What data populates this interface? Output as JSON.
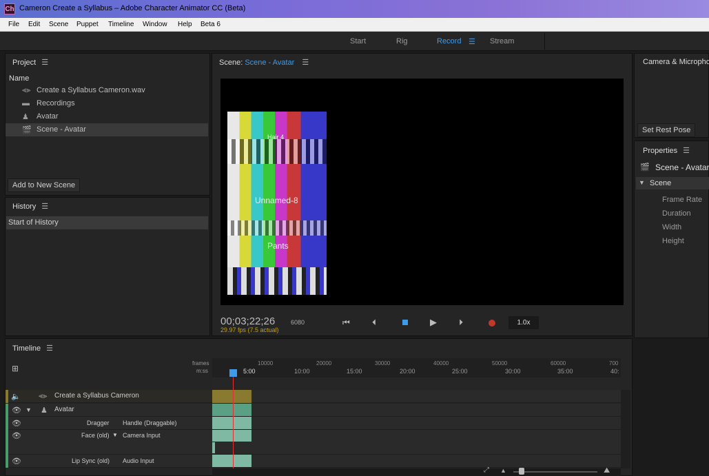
{
  "window": {
    "logo": "Ch",
    "title": "Cameron Create a Syllabus – Adobe Character Animator CC (Beta)"
  },
  "menu": [
    "File",
    "Edit",
    "Scene",
    "Puppet",
    "Timeline",
    "Window",
    "Help",
    "Beta 6"
  ],
  "workspaces": [
    "Start",
    "Rig",
    "Record",
    "Stream"
  ],
  "project": {
    "title": "Project",
    "col": "Name",
    "items": [
      {
        "icon": "audio-waveform-icon",
        "label": "Create a Syllabus Cameron.wav"
      },
      {
        "icon": "folder-icon",
        "label": "Recordings"
      },
      {
        "icon": "puppet-icon",
        "label": "Avatar"
      },
      {
        "icon": "clapperboard-icon",
        "label": "Scene - Avatar"
      }
    ],
    "add_button": "Add to New Scene"
  },
  "history": {
    "title": "History",
    "items": [
      "Start of History"
    ]
  },
  "scene": {
    "prefix": "Scene:",
    "name": "Scene - Avatar",
    "labels": [
      "Hair 4",
      "Unnamed-8",
      "Pants"
    ],
    "timecode": "00;03;22;26",
    "fps": "29.97 fps (7.5 actual)",
    "frame": "6080",
    "speed": "1.0x"
  },
  "camera": {
    "title": "Camera & Microphone",
    "rest": "Set Rest Pose"
  },
  "properties": {
    "title": "Properties",
    "scene_name": "Scene - Avatar",
    "section": "Scene",
    "fields": [
      "Frame Rate",
      "Duration",
      "Width",
      "Height"
    ]
  },
  "timeline": {
    "title": "Timeline",
    "frames_label": "frames",
    "mss_label": "m:ss",
    "frame_ticks": [
      "10000",
      "20000",
      "30000",
      "40000",
      "50000",
      "60000",
      "700"
    ],
    "time_ticks": [
      "5:00",
      "10:00",
      "15:00",
      "20:00",
      "25:00",
      "30:00",
      "35:00",
      "40:"
    ],
    "tracks": [
      {
        "name": "Create a Syllabus Cameron",
        "sub": ""
      },
      {
        "name": "Avatar",
        "sub": ""
      },
      {
        "name": "Dragger",
        "sub": "Handle (Draggable)"
      },
      {
        "name": "Face (old)",
        "sub": "Camera Input"
      },
      {
        "name": "",
        "sub": ""
      },
      {
        "name": "Lip Sync (old)",
        "sub": "Audio Input"
      }
    ]
  },
  "colors": {
    "accent": "#3d9be9",
    "record": "#c0392b",
    "clip": "#7fb9a4",
    "audio_clip": "#8a7a30",
    "playhead": "#e03030"
  }
}
